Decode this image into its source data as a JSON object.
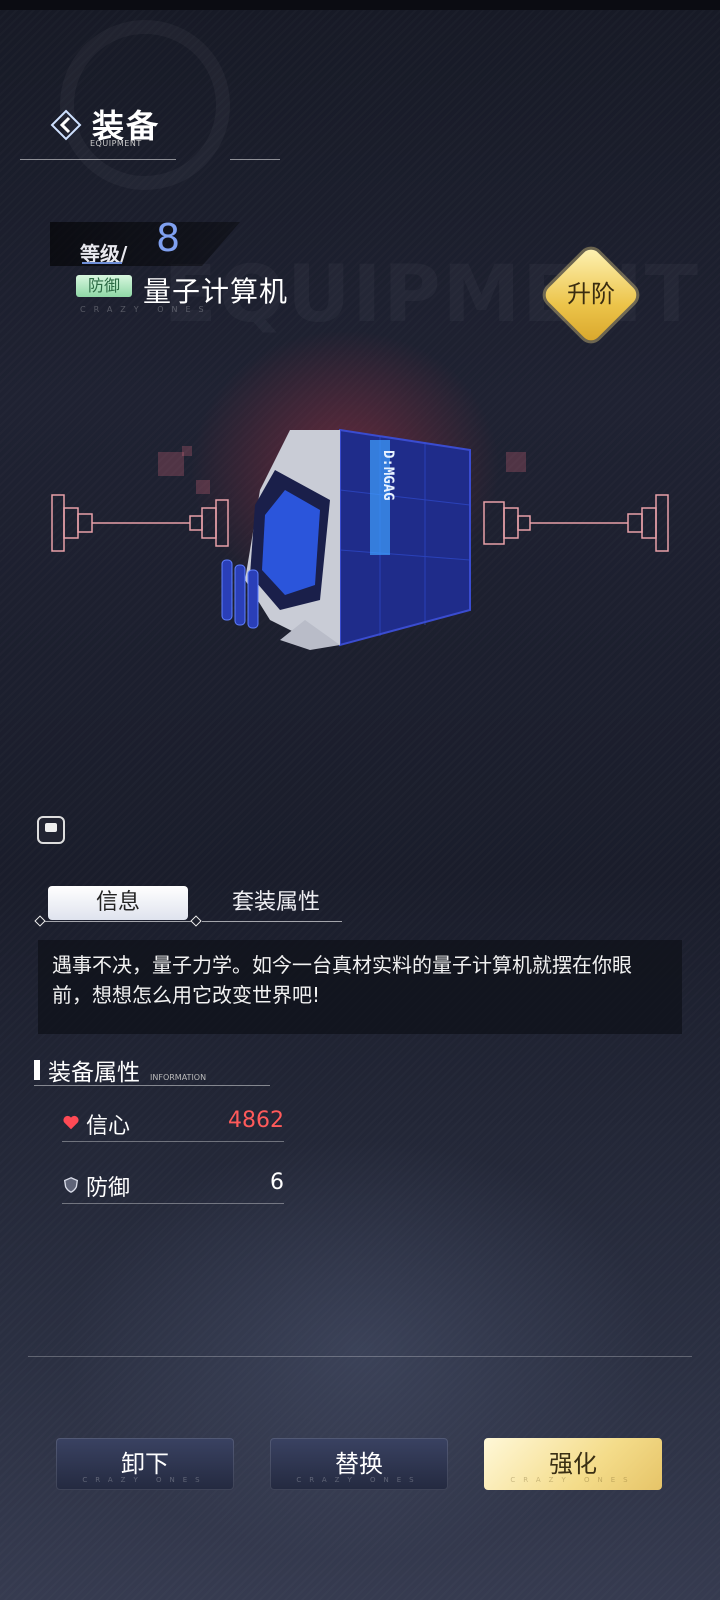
{
  "header": {
    "title": "装备",
    "subtitle": "EQUIPMENT",
    "icon": "back-arrow-icon"
  },
  "equipment": {
    "level_label": "等级/",
    "level_value": "8",
    "type_badge": "防御",
    "name": "量子计算机",
    "tagline": "CRAZY ONES",
    "machine_logo": "D:MGAG"
  },
  "upgrade_button": {
    "label": "升阶"
  },
  "tabs": [
    {
      "label": "信息",
      "active": true
    },
    {
      "label": "套装属性",
      "active": false
    }
  ],
  "description": "遇事不决，量子力学。如今一台真材实料的量子计算机就摆在你眼前，想想怎么用它改变世界吧!",
  "attributes": {
    "title": "装备属性",
    "subtitle": "INFORMATION",
    "stats": [
      {
        "label": "信心",
        "value": "4862",
        "icon": "heart-icon",
        "color": "#ff5a5a"
      },
      {
        "label": "防御",
        "value": "6",
        "icon": "shield-icon",
        "color": "#ffffff"
      }
    ]
  },
  "buttons": {
    "unequip": "卸下",
    "replace": "替换",
    "enhance": "强化",
    "tagline": "CRAZY ONES"
  },
  "colors": {
    "accent_blue": "#7fa0f0",
    "gold": "#ecc44a",
    "badge_green": "#8fd8a6",
    "stat_red": "#ff5a5a"
  }
}
